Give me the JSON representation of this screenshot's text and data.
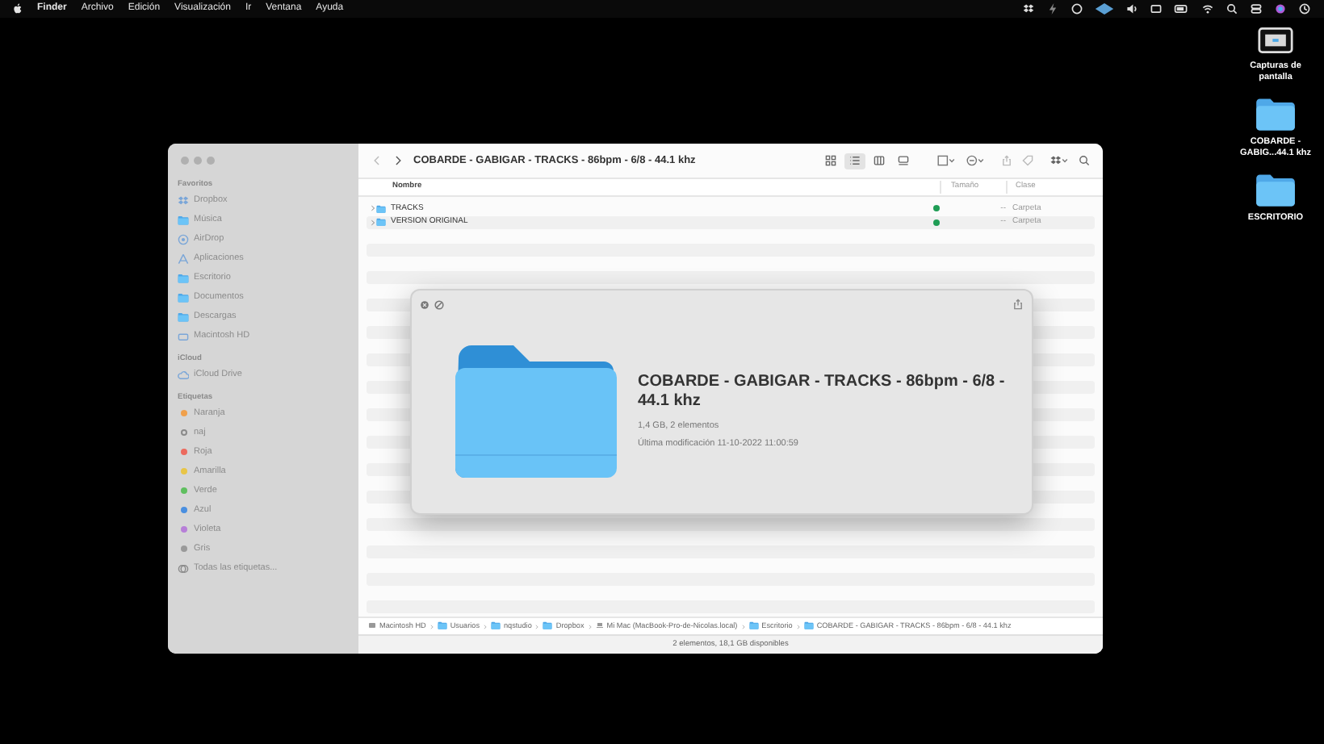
{
  "menu_bar": {
    "app": "Finder",
    "items": [
      "Archivo",
      "Edición",
      "Visualización",
      "Ir",
      "Ventana",
      "Ayuda"
    ]
  },
  "desktop_icons": [
    {
      "kind": "screenshots",
      "label": "Capturas de pantalla"
    },
    {
      "kind": "folder",
      "label": "COBARDE - GABIG...44.1 khz"
    },
    {
      "kind": "folder",
      "label": "ESCRITORIO"
    }
  ],
  "finder": {
    "title": "COBARDE - GABIGAR - TRACKS - 86bpm - 6/8 - 44.1 khz",
    "views": [
      {
        "kind": "icons",
        "selected": false
      },
      {
        "kind": "list",
        "selected": true
      },
      {
        "kind": "columns",
        "selected": false
      },
      {
        "kind": "gallery",
        "selected": false
      }
    ],
    "sidebar": [
      {
        "heading": "Favoritos",
        "items": [
          {
            "kind": "dropbox",
            "label": "Dropbox"
          },
          {
            "kind": "folder",
            "label": "Música"
          },
          {
            "kind": "airdrop",
            "label": "AirDrop"
          },
          {
            "kind": "apps",
            "label": "Aplicaciones"
          },
          {
            "kind": "folder",
            "label": "Escritorio"
          },
          {
            "kind": "folder",
            "label": "Documentos"
          },
          {
            "kind": "folder",
            "label": "Descargas"
          },
          {
            "kind": "disk",
            "label": "Macintosh HD"
          }
        ]
      },
      {
        "heading": "iCloud",
        "items": [
          {
            "kind": "cloud",
            "label": "iCloud Drive"
          }
        ]
      },
      {
        "heading": "Etiquetas",
        "items": [
          {
            "kind": "tag",
            "label": "Naranja",
            "color": "#f0a04b"
          },
          {
            "kind": "ring",
            "label": "naj"
          },
          {
            "kind": "tag",
            "label": "Roja",
            "color": "#ec6a5e"
          },
          {
            "kind": "tag",
            "label": "Amarilla",
            "color": "#e8c547"
          },
          {
            "kind": "tag",
            "label": "Verde",
            "color": "#5fbf5f"
          },
          {
            "kind": "tag",
            "label": "Azul",
            "color": "#4a8fe0"
          },
          {
            "kind": "tag",
            "label": "Violeta",
            "color": "#b77fd8"
          },
          {
            "kind": "tag",
            "label": "Gris",
            "color": "#9a9a9a"
          },
          {
            "kind": "alltags",
            "label": "Todas las etiquetas..."
          }
        ]
      }
    ],
    "columns": [
      "Nombre",
      "Tamaño",
      "Clase"
    ],
    "rows": [
      {
        "name": "TRACKS",
        "synced": true,
        "size": "--",
        "kind": "Carpeta"
      },
      {
        "name": "VERSION ORIGINAL",
        "synced": true,
        "size": "--",
        "kind": "Carpeta"
      }
    ],
    "path": [
      {
        "kind": "disk",
        "label": "Macintosh HD"
      },
      {
        "kind": "folder",
        "label": "Usuarios"
      },
      {
        "kind": "folder",
        "label": "nqstudio"
      },
      {
        "kind": "folder",
        "label": "Dropbox"
      },
      {
        "kind": "computer",
        "label": "Mi Mac (MacBook-Pro-de-Nicolas.local)"
      },
      {
        "kind": "folder",
        "label": "Escritorio"
      },
      {
        "kind": "folder",
        "label": "COBARDE - GABIGAR - TRACKS - 86bpm - 6/8 - 44.1 khz"
      }
    ],
    "status": "2 elementos, 18,1 GB disponibles"
  },
  "quick_look": {
    "title": "COBARDE - GABIGAR - TRACKS - 86bpm - 6/8 - 44.1 khz",
    "details": "1,4 GB, 2 elementos",
    "modified": "Última modificación 11-10-2022 11:00:59"
  }
}
